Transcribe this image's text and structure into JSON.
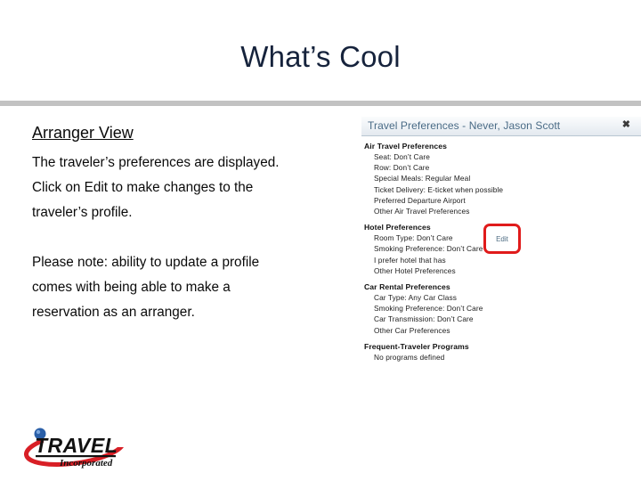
{
  "slide": {
    "title": "What’s Cool",
    "title_color": "#16233c",
    "divider_color": "#c2c2c2"
  },
  "content": {
    "heading": "Arranger View",
    "paragraph1": [
      "The traveler’s preferences are displayed.",
      "Click on Edit to make changes to the",
      "traveler’s profile."
    ],
    "paragraph2": [
      "Please note:  ability to update a profile",
      "comes with being able to make a",
      "reservation as an arranger."
    ]
  },
  "screenshot": {
    "window_title": "Travel Preferences - Never, Jason Scott",
    "close_icon": "✖",
    "groups": [
      {
        "title": "Air Travel Preferences",
        "items": [
          "Seat: Don’t Care",
          "Row: Don’t Care",
          "Special Meals: Regular Meal",
          "Ticket Delivery: E-ticket when possible",
          "Preferred Departure Airport",
          "Other Air Travel Preferences"
        ]
      },
      {
        "title": "Hotel Preferences",
        "items": [
          "Room Type: Don’t Care",
          "Smoking Preference: Don’t Care",
          "I prefer hotel that has",
          "Other Hotel Preferences"
        ]
      },
      {
        "title": "Car Rental Preferences",
        "items": [
          "Car Type: Any Car Class",
          "Smoking Preference: Don’t Care",
          "Car Transmission: Don’t Care",
          "Other Car Preferences"
        ]
      },
      {
        "title": "Frequent-Traveler Programs",
        "items": [
          "No programs defined"
        ]
      }
    ],
    "edit_button_label": "Edit",
    "highlight_color": "#e01b1b"
  },
  "logo": {
    "name": "TRAVEL",
    "tagline": "Incorporated",
    "swoosh_color": "#d81f26",
    "sphere_color": "#2a5fa8"
  }
}
